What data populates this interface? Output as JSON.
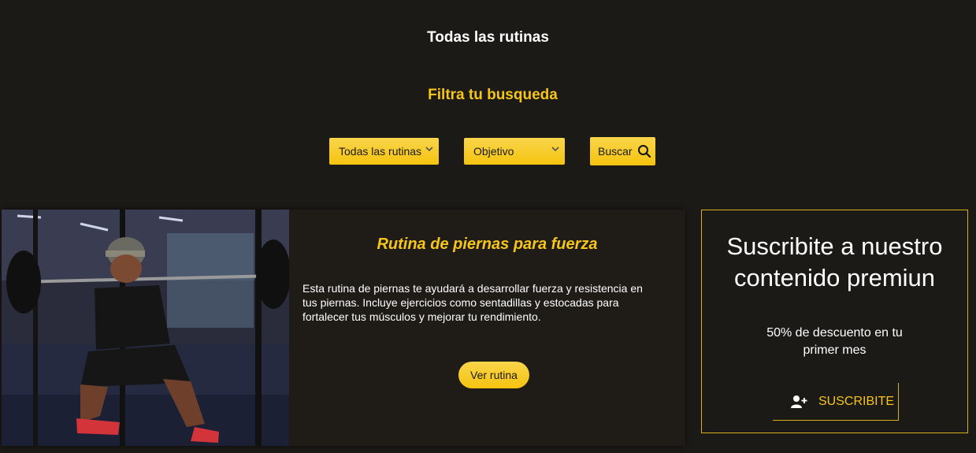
{
  "header": {
    "title": "Todas las rutinas"
  },
  "filters": {
    "title": "Filtra tu busqueda",
    "type_select": {
      "selected": "Todas las rutinas"
    },
    "goal_select": {
      "selected": "Objetivo"
    },
    "search_label": "Buscar"
  },
  "routine_card": {
    "title": "Rutina de piernas para fuerza",
    "description": "Esta rutina de piernas te ayudará a desarrollar fuerza y resistencia en tus piernas. Incluye ejercicios como sentadillas y estocadas para fortalecer tus músculos y mejorar tu rendimiento.",
    "button_label": "Ver rutina",
    "image_subject": "man-squatting-barbell-gym-photo"
  },
  "promo": {
    "title": "Suscribite a nuestro contenido premiun",
    "discount": "50% de descuento en tu primer mes",
    "button_label": "SUSCRIBITE",
    "button_icon": "user-plus-icon"
  },
  "colors": {
    "background": "#1c1a17",
    "accent": "#f5c518",
    "card": "#1f1c18",
    "text": "#ffffff"
  }
}
